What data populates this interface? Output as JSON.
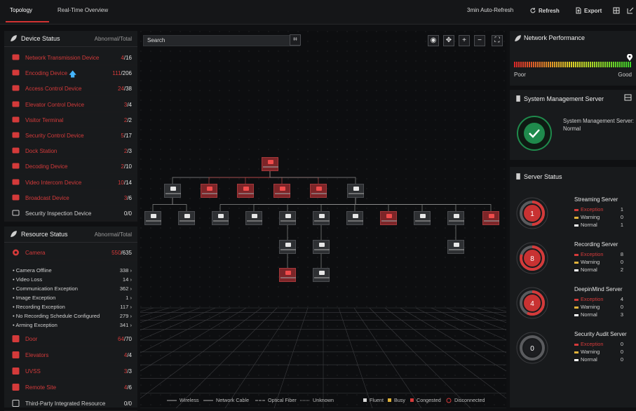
{
  "tabs": [
    {
      "label": "Topology"
    },
    {
      "label": "Real-Time Overview"
    }
  ],
  "toolbar": {
    "auto_refresh": "3min Auto-Refresh",
    "refresh": "Refresh",
    "export": "Export"
  },
  "device_status": {
    "title": "Device Status",
    "subtitle": "Abnormal/Total",
    "items": [
      {
        "label": "Network Transmission Device",
        "abn": "4",
        "total": "/16",
        "status": "red"
      },
      {
        "label": "Encoding Device",
        "abn": "111",
        "total": "/206",
        "status": "red"
      },
      {
        "label": "Access Control Device",
        "abn": "24",
        "total": "/38",
        "status": "red"
      },
      {
        "label": "Elevator Control Device",
        "abn": "3",
        "total": "/4",
        "status": "red"
      },
      {
        "label": "Visitor Terminal",
        "abn": "2",
        "total": "/2",
        "status": "red"
      },
      {
        "label": "Security Control Device",
        "abn": "5",
        "total": "/17",
        "status": "red"
      },
      {
        "label": "Dock Station",
        "abn": "2",
        "total": "/3",
        "status": "red"
      },
      {
        "label": "Decoding Device",
        "abn": "2",
        "total": "/10",
        "status": "red"
      },
      {
        "label": "Video Intercom Device",
        "abn": "10",
        "total": "/14",
        "status": "red"
      },
      {
        "label": "Broadcast Device",
        "abn": "3",
        "total": "/6",
        "status": "red"
      },
      {
        "label": "Security Inspection Device",
        "abn": "0",
        "total": "/0",
        "status": "normal"
      }
    ]
  },
  "resource_status": {
    "title": "Resource Status",
    "subtitle": "Abnormal/Total",
    "camera": {
      "label": "Camera",
      "abn": "550",
      "total": "/635"
    },
    "camera_items": [
      {
        "label": "Camera Offline",
        "value": "338"
      },
      {
        "label": "Video Loss",
        "value": "14"
      },
      {
        "label": "Communication Exception",
        "value": "362"
      },
      {
        "label": "Image Exception",
        "value": "1"
      },
      {
        "label": "Recording Exception",
        "value": "117"
      },
      {
        "label": "No Recording Schedule Configured",
        "value": "279"
      },
      {
        "label": "Arming Exception",
        "value": "341"
      }
    ],
    "others": [
      {
        "label": "Door",
        "abn": "64",
        "total": "/70"
      },
      {
        "label": "Elevators",
        "abn": "4",
        "total": "/4"
      },
      {
        "label": "UVSS",
        "abn": "3",
        "total": "/3"
      },
      {
        "label": "Remote Site",
        "abn": "4",
        "total": "/6"
      },
      {
        "label": "Third-Party Integrated Resource",
        "abn": "0",
        "total": "/0"
      }
    ]
  },
  "map": {
    "search_placeholder": "Search",
    "legend": [
      {
        "label": "Wireless"
      },
      {
        "label": "Network Cable"
      },
      {
        "label": "Optical Fiber"
      },
      {
        "label": "Unknown"
      },
      {
        "label": "Fluent",
        "color": "#d9d9d9"
      },
      {
        "label": "Busy",
        "color": "#e0b23a"
      },
      {
        "label": "Congested",
        "color": "#d43a3a"
      },
      {
        "label": "Disconnected",
        "color": "#d43a3a"
      }
    ]
  },
  "network_performance": {
    "title": "Network Performance",
    "poor": "Poor",
    "good": "Good"
  },
  "system_mgmt": {
    "title": "System Management Server",
    "label": "System Management Server:",
    "status": "Normal"
  },
  "server_status": {
    "title": "Server Status",
    "servers": [
      {
        "name": "Streaming Server",
        "ring": "1",
        "exception": "1",
        "warning": "0",
        "normal": "1"
      },
      {
        "name": "Recording Server",
        "ring": "8",
        "exception": "8",
        "warning": "0",
        "normal": "2"
      },
      {
        "name": "DeepinMind Server",
        "ring": "4",
        "exception": "4",
        "warning": "0",
        "normal": "3"
      },
      {
        "name": "Security Audit Server",
        "ring": "0",
        "exception": "0",
        "warning": "0",
        "normal": "0"
      }
    ],
    "labels": {
      "exception": "Exception",
      "warning": "Warning",
      "normal": "Normal"
    }
  }
}
